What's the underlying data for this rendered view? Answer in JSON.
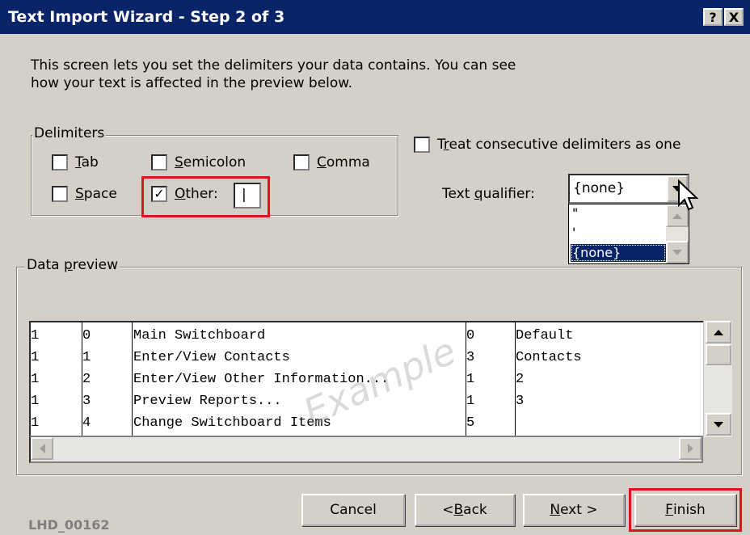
{
  "window": {
    "title": "Text Import Wizard - Step 2 of 3",
    "help_label": "?",
    "close_label": "X"
  },
  "description": {
    "line1": "This screen lets you set the delimiters your data contains.  You can see",
    "line2": "how your text is affected in the preview below."
  },
  "delimiters": {
    "group_label": "Delimiters",
    "tab": {
      "label_key": "T",
      "label_rest": "ab",
      "checked": false
    },
    "semicolon": {
      "label_key": "S",
      "label_rest": "emicolon",
      "checked": false
    },
    "comma": {
      "label_key": "C",
      "label_rest": "omma",
      "checked": false
    },
    "space": {
      "label_key": "S",
      "label_rest": "pace",
      "checked": false
    },
    "other": {
      "label_key": "O",
      "label_rest": "ther:",
      "checked": true,
      "value": "|"
    }
  },
  "consecutive": {
    "label_pre": "T",
    "label_key": "r",
    "label_rest": "eat consecutive delimiters as one",
    "checked": false
  },
  "text_qualifier": {
    "label_pre": "Text ",
    "label_key": "q",
    "label_rest": "ualifier:",
    "selected": "{none}",
    "options": [
      "\"",
      "'",
      "{none}"
    ]
  },
  "data_preview": {
    "label_pre": "Data ",
    "label_key": "p",
    "label_rest": "review",
    "watermark": "Example",
    "columns": [
      [
        "1",
        "1",
        "1",
        "1",
        "1"
      ],
      [
        "0",
        "1",
        "2",
        "3",
        "4"
      ],
      [
        "Main Switchboard",
        "Enter/View Contacts",
        "Enter/View Other Information...",
        "Preview Reports...",
        "Change Switchboard Items"
      ],
      [
        "0",
        "3",
        "1",
        "1",
        "5"
      ],
      [
        "Default",
        "Contacts",
        "2",
        "3",
        ""
      ]
    ]
  },
  "buttons": {
    "cancel": "Cancel",
    "back_pre": "< ",
    "back_key": "B",
    "back_rest": "ack",
    "next_key": "N",
    "next_rest": "ext >",
    "finish_key": "F",
    "finish_rest": "inish"
  },
  "footer_id": "LHD_00162",
  "colors": {
    "title_bg": "#0a246a",
    "dialog_bg": "#d4d0c8",
    "highlight_red": "#e0141e"
  }
}
